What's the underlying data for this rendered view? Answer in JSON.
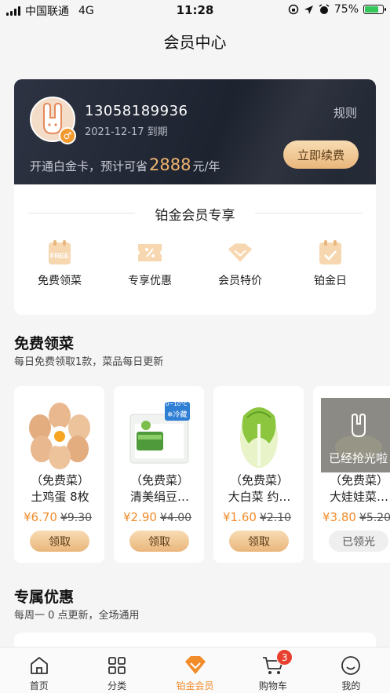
{
  "status_bar": {
    "carrier": "中国联通",
    "network": "4G",
    "time": "11:28",
    "battery": "75%",
    "battery_level": 0.75
  },
  "nav": {
    "title": "会员中心"
  },
  "member_card": {
    "phone": "13058189936",
    "expire": "2021-12-17 到期",
    "rules": "规则",
    "save_prefix": "开通白金卡，预计可省",
    "save_amount": "2888",
    "save_suffix": "元/年",
    "renew": "立即续费",
    "accent": "#f0b56e"
  },
  "privileges": {
    "title": "铂金会员专享",
    "items": [
      {
        "label": "免费领菜",
        "icon": "free-tag-icon"
      },
      {
        "label": "专享优惠",
        "icon": "coupon-icon"
      },
      {
        "label": "会员特价",
        "icon": "diamond-icon"
      },
      {
        "label": "铂金日",
        "icon": "calendar-icon"
      }
    ]
  },
  "free_veg": {
    "title": "免费领菜",
    "subtitle": "每日免费领取1款，菜品每日更新",
    "items": [
      {
        "tag": "（免费菜）",
        "name": "土鸡蛋 8枚",
        "price": "¥6.70",
        "old_price": "¥9.30",
        "action": "领取"
      },
      {
        "tag": "（免费菜）",
        "name": "清美绢豆…",
        "price": "¥2.90",
        "old_price": "¥4.00",
        "action": "领取",
        "pkg_label": "0~10°C",
        "pkg_cold": "❄冷藏"
      },
      {
        "tag": "（免费菜）",
        "name": "大白菜 约…",
        "price": "¥1.60",
        "old_price": "¥2.10",
        "action": "领取"
      },
      {
        "tag": "（免费菜）",
        "name": "大娃娃菜…",
        "price": "¥3.80",
        "old_price": "¥5.20",
        "action": "已领光",
        "overlay": "已经抢光啦"
      }
    ]
  },
  "exclusive": {
    "title": "专属优惠",
    "subtitle": "每周一 0 点更新，全场通用"
  },
  "tabs": [
    {
      "label": "首页",
      "icon": "home-icon"
    },
    {
      "label": "分类",
      "icon": "grid-icon"
    },
    {
      "label": "铂金会员",
      "icon": "diamond-icon"
    },
    {
      "label": "购物车",
      "icon": "cart-icon",
      "badge": "3"
    },
    {
      "label": "我的",
      "icon": "smile-icon"
    }
  ],
  "colors": {
    "accent": "#f28b2a",
    "card_dark": "#1e2330",
    "badge_red": "#e8402f"
  }
}
